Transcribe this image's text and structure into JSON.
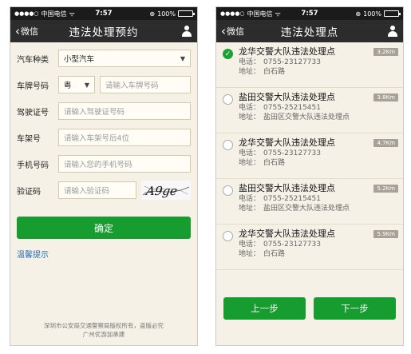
{
  "status_bar": {
    "signal": "●●●●○",
    "carrier": "中国电信",
    "wifi": "ᯤ",
    "time": "7:57",
    "lock": "⊕",
    "battery": "100%",
    "battery_level": 1.0
  },
  "left_screen": {
    "back_label": "微信",
    "title": "违法处理预约",
    "form": {
      "vehicle_type": {
        "label": "汽车种类",
        "value": "小型汽车"
      },
      "plate": {
        "label": "车牌号码",
        "province": "粤",
        "placeholder": "请输入车牌号码"
      },
      "license": {
        "label": "驾驶证号",
        "placeholder": "请输入驾驶证号码"
      },
      "frame": {
        "label": "车架号",
        "placeholder": "请输入车架号后4位"
      },
      "phone": {
        "label": "手机号码",
        "placeholder": "请输入您的手机号码"
      },
      "captcha": {
        "label": "验证码",
        "placeholder": "请输入验证码",
        "image_text": "A9ge"
      }
    },
    "confirm_label": "确定",
    "hint_link": "温馨提示",
    "footer_line1": "深圳市公安局交通警察局版权所有，盗版必究",
    "footer_line2": "广州优游加承建"
  },
  "right_screen": {
    "back_label": "微信",
    "title": "违法处理点",
    "phone_label": "电话：",
    "address_label": "地址：",
    "items": [
      {
        "name": "龙华交警大队违法处理点",
        "phone": "0755-23127733",
        "address": "白石路",
        "distance": "3.2Km",
        "checked": true
      },
      {
        "name": "盐田交警大队违法处理点",
        "phone": "0755-25215451",
        "address": "盐田区交警大队违法处理点",
        "distance": "3.8Km",
        "checked": false
      },
      {
        "name": "龙华交警大队违法处理点",
        "phone": "0755-23127733",
        "address": "白石路",
        "distance": "4.7Km",
        "checked": false
      },
      {
        "name": "盐田交警大队违法处理点",
        "phone": "0755-25215451",
        "address": "盐田区交警大队违法处理点",
        "distance": "5.2Km",
        "checked": false
      },
      {
        "name": "龙华交警大队违法处理点",
        "phone": "0755-23127733",
        "address": "白石路",
        "distance": "5.9Km",
        "checked": false
      }
    ],
    "prev_label": "上一步",
    "next_label": "下一步"
  },
  "colors": {
    "accent_green": "#179c2f",
    "link_blue": "#2b6db7",
    "navbar": "#2c2c2c",
    "background": "#f5f1e6"
  },
  "icons": {
    "back": "chevron-left-icon",
    "user": "user-icon",
    "check": "check-icon"
  }
}
